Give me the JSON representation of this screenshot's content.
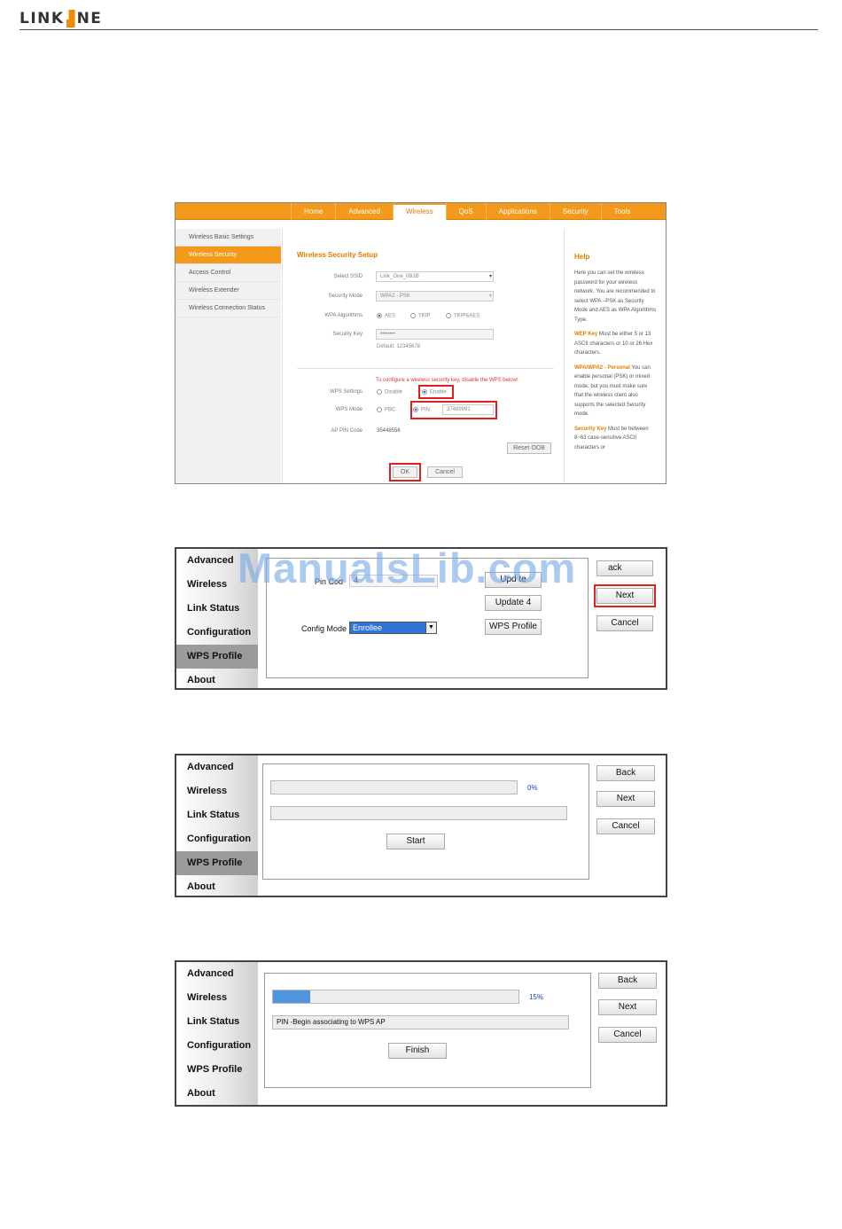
{
  "header": {
    "brand_left": "LINK",
    "brand_right": "NE"
  },
  "router": {
    "nav": [
      "Home",
      "Advanced",
      "Wireless",
      "QoS",
      "Applications",
      "Security",
      "Tools"
    ],
    "active_tab": "Wireless",
    "sidebar": [
      "Wireless Basic Settings",
      "Wireless Security",
      "Access Control",
      "Wireless Extender",
      "Wireless Connection Status"
    ],
    "section_title": "Wireless Security Setup",
    "select_ssid_label": "Select SSID",
    "select_ssid_value": "Link_One_0B1B",
    "security_mode_label": "Security Mode",
    "security_mode_value": "WPA2 - PSK",
    "wpa_algorithms_label": "WPA Algorithms",
    "algo_options": [
      "AES",
      "TKIP",
      "TKIP&AES"
    ],
    "security_key_label": "Security Key",
    "security_key_value": "••••••••",
    "default_hint": "Default: 12345678",
    "wps_warning": "To configure a wireless security key, disable the WPS below!",
    "wps_settings_label": "WPS Settings",
    "wps_disable": "Disable",
    "wps_enable": "Enable",
    "wps_mode_label": "WPS Mode",
    "wps_pbc": "PBC",
    "wps_pin": "PIN",
    "wps_pin_value": "37489991",
    "ap_pin_label": "AP PIN Code",
    "ap_pin_value": "35448556",
    "reset_oob": "Reset OOB",
    "ok": "OK",
    "cancel": "Cancel",
    "help_title": "Help",
    "help_intro": "Here you can set the wireless password for your wireless network. You are recommended to select WPA –PSK as Security Mode and AES as WPA Algorithms Type.",
    "help_wep_key": "WEP Key",
    "help_wep_text": " Must be either 5 or 13 ASCII characters or 10 or 26 Hex characters.",
    "help_wpa_key": "WPA/WPA2 - Personal",
    "help_wpa_text": " You can enable personal (PSK) or mixed mode, but you must make sure that the wireless client also supports the selected Security mode.",
    "help_seckey_key": "Security Key",
    "help_seckey_text": " Must be between 8~63 case-sensitive ASCII characters or"
  },
  "wps_sidebar": [
    "Advanced",
    "Wireless",
    "Link Status",
    "Configuration",
    "WPS Profile",
    "About"
  ],
  "dialog1": {
    "pin_label": "Pin Cod",
    "pin_value": "4",
    "update_partial": "Upd te",
    "update4": "Update 4",
    "config_mode_label": "Config Mode",
    "config_mode_value": "Enrollee",
    "wps_profile_btn": "WPS Profile",
    "back_partial": "ack",
    "next": "Next",
    "cancel": "Cancel"
  },
  "dialog2": {
    "progress_percent": "0%",
    "progress": 0,
    "start": "Start",
    "back": "Back",
    "next": "Next",
    "cancel": "Cancel"
  },
  "dialog3": {
    "progress_percent": "15%",
    "progress": 0.15,
    "status_text": "PIN -Begin associating to WPS AP",
    "finish": "Finish",
    "back": "Back",
    "next": "Next",
    "cancel": "Cancel"
  },
  "watermark": "ManualsLib.com"
}
